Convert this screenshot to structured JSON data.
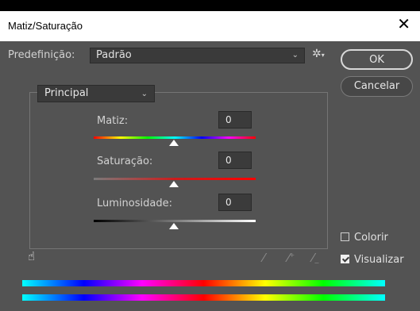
{
  "window": {
    "title": "Matiz/Saturação",
    "close_symbol": "✕"
  },
  "preset": {
    "label": "Predefinição:",
    "value": "Padrão"
  },
  "buttons": {
    "ok": "OK",
    "cancel": "Cancelar"
  },
  "channel": {
    "value": "Principal"
  },
  "sliders": {
    "hue": {
      "label": "Matiz:",
      "value": "0"
    },
    "saturation": {
      "label": "Saturação:",
      "value": "0"
    },
    "lightness": {
      "label": "Luminosidade:",
      "value": "0"
    }
  },
  "options": {
    "colorize": {
      "label": "Colorir",
      "checked": false
    },
    "preview": {
      "label": "Visualizar",
      "checked": true
    }
  },
  "colors": {
    "dialog_bg": "#535353",
    "titlebar_bg": "#ffffff",
    "field_bg": "#3a3a3a"
  },
  "icons": [
    "close-icon",
    "chevron-down-icon",
    "gear-icon",
    "hand-target-icon",
    "eyedropper-icon",
    "eyedropper-plus-icon",
    "eyedropper-minus-icon",
    "checkbox-icon",
    "slider-thumb-icon"
  ]
}
